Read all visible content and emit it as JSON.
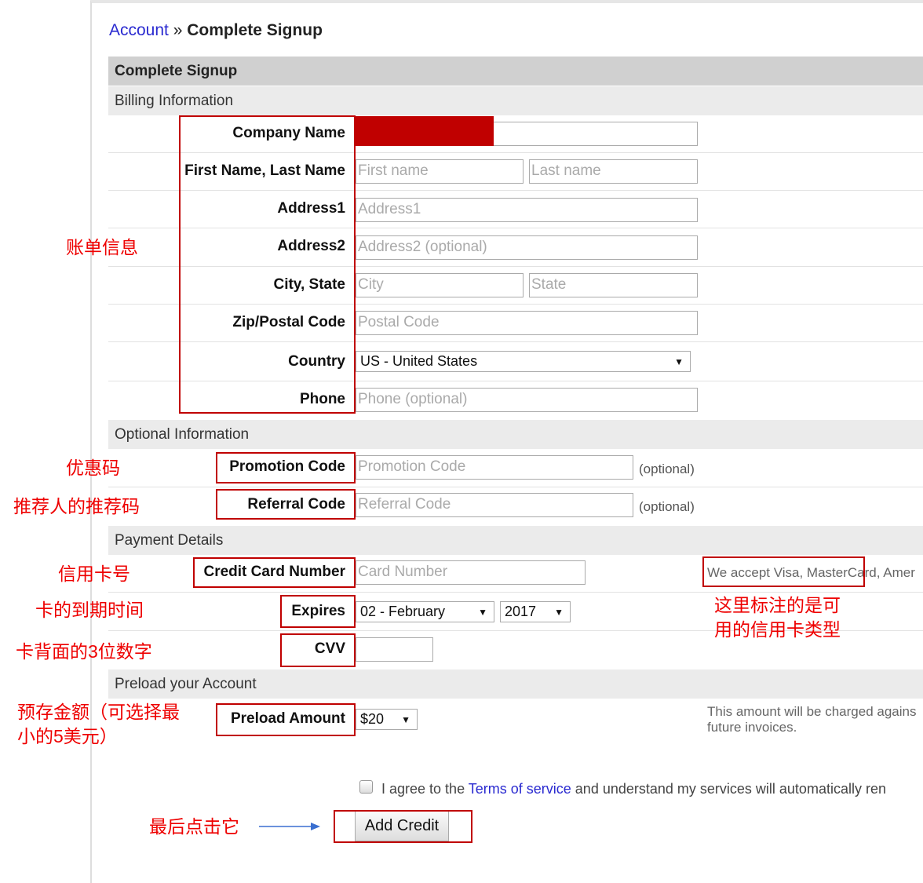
{
  "breadcrumb": {
    "link": "Account",
    "sep": "»",
    "current": "Complete Signup"
  },
  "form_title": "Complete Signup",
  "sections": {
    "billing": "Billing Information",
    "optional": "Optional Information",
    "payment": "Payment Details",
    "preload": "Preload your Account"
  },
  "labels": {
    "company": "Company Name",
    "name": "First Name, Last Name",
    "address1": "Address1",
    "address2": "Address2",
    "city_state": "City, State",
    "zip": "Zip/Postal Code",
    "country": "Country",
    "phone": "Phone",
    "promo": "Promotion Code",
    "referral": "Referral Code",
    "cc": "Credit Card Number",
    "expires": "Expires",
    "cvv": "CVV",
    "preload": "Preload Amount"
  },
  "placeholders": {
    "first": "First name",
    "last": "Last name",
    "address1": "Address1",
    "address2": "Address2 (optional)",
    "city": "City",
    "state": "State",
    "zip": "Postal Code",
    "phone": "Phone (optional)",
    "promo": "Promotion Code",
    "referral": "Referral Code",
    "cc": "Card Number"
  },
  "values": {
    "country": "US - United States",
    "exp_month": "02 - February",
    "exp_year": "2017",
    "preload": "$20"
  },
  "optional_note": "(optional)",
  "accept_note": "We accept Visa, MasterCard, Amer",
  "preload_note": "This amount will be charged agains future invoices.",
  "terms": {
    "pre": "I agree to the ",
    "link": "Terms of service",
    "post": " and understand my services will automatically ren"
  },
  "submit": "Add Credit",
  "annotations": {
    "billing": "账单信息",
    "promo": "优惠码",
    "referral": "推荐人的推荐码",
    "cc": "信用卡号",
    "expires": "卡的到期时间",
    "cvv": "卡背面的3位数字",
    "preload": "预存金额（可选择最小的5美元）",
    "accept": "这里标注的是可用的信用卡类型",
    "submit": "最后点击它"
  },
  "colors": {
    "annotation": "#e00000",
    "box": "#c00000",
    "link": "#2a2ad0"
  }
}
